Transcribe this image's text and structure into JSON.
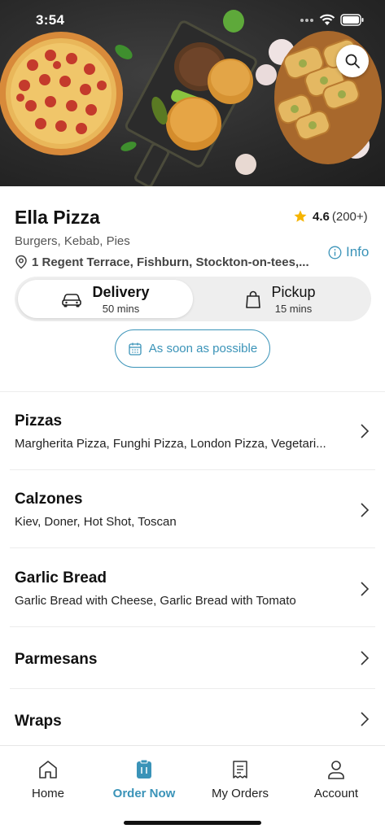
{
  "status_bar": {
    "time": "3:54"
  },
  "restaurant": {
    "name": "Ella Pizza",
    "rating": "4.6",
    "review_count": "(200+)",
    "cuisine": "Burgers, Kebab, Pies",
    "address": "1 Regent Terrace, Fishburn, Stockton-on-tees,...",
    "info_label": "Info"
  },
  "order_mode": {
    "delivery": {
      "label": "Delivery",
      "time": "50 mins",
      "selected": true
    },
    "pickup": {
      "label": "Pickup",
      "time": "15 mins",
      "selected": false
    }
  },
  "schedule": {
    "label": "As soon as possible"
  },
  "categories": [
    {
      "title": "Pizzas",
      "items": "Margherita Pizza, Funghi Pizza, London Pizza, Vegetari..."
    },
    {
      "title": "Calzones",
      "items": "Kiev, Doner, Hot Shot, Toscan"
    },
    {
      "title": "Garlic Bread",
      "items": "Garlic Bread with Cheese, Garlic Bread with Tomato"
    },
    {
      "title": "Parmesans",
      "items": ""
    },
    {
      "title": "Wraps",
      "items": ""
    }
  ],
  "bottom_nav": [
    {
      "label": "Home",
      "icon": "home-icon",
      "active": false
    },
    {
      "label": "Order Now",
      "icon": "order-icon",
      "active": true
    },
    {
      "label": "My Orders",
      "icon": "receipt-icon",
      "active": false
    },
    {
      "label": "Account",
      "icon": "person-icon",
      "active": false
    }
  ],
  "colors": {
    "accent": "#3a93b8",
    "star": "#f5b400"
  }
}
